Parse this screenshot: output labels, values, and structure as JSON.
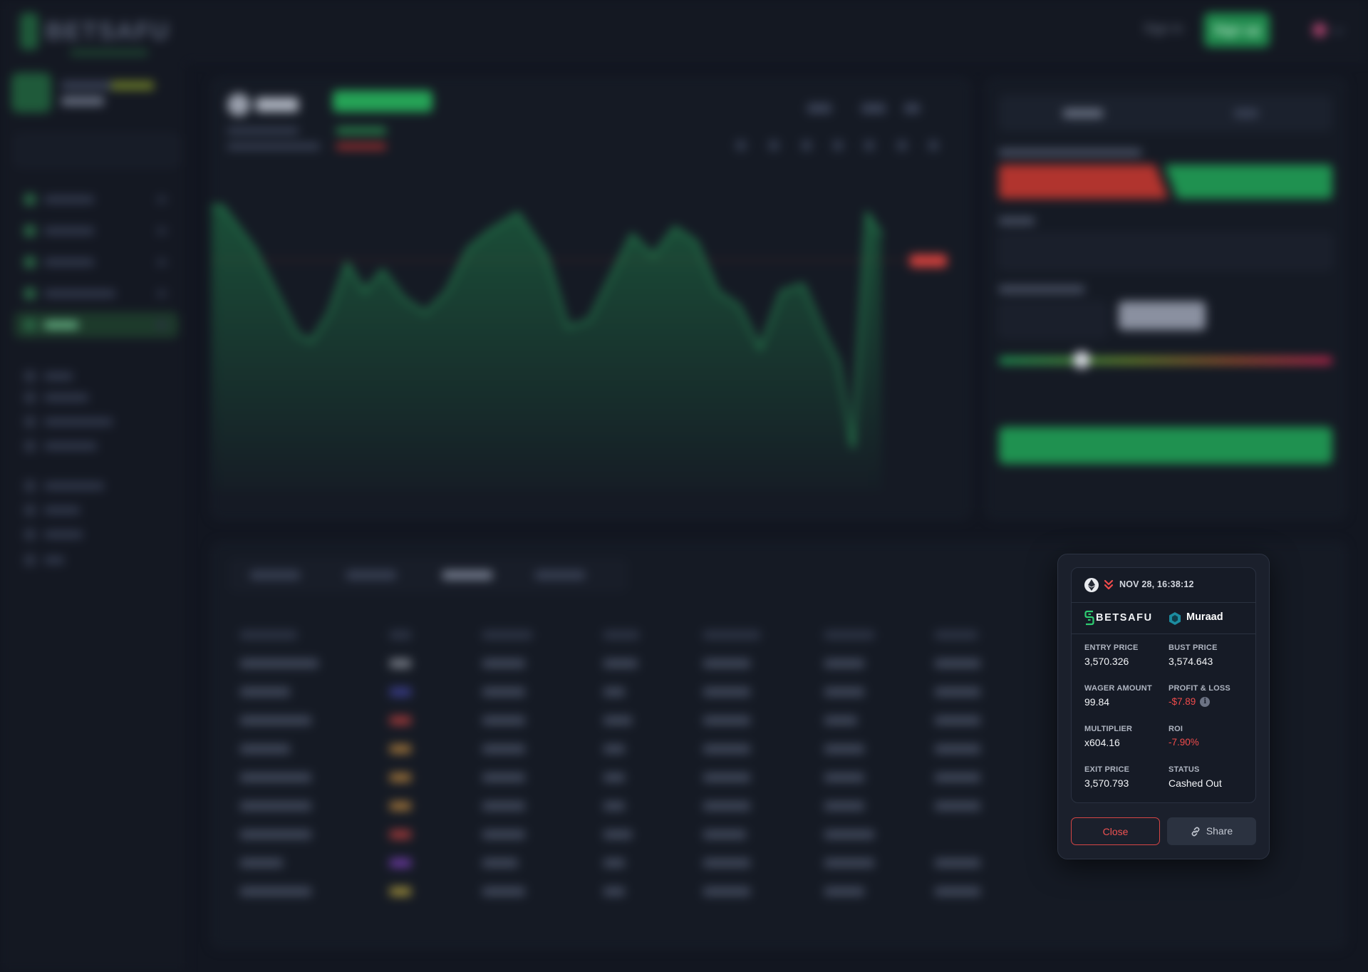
{
  "background": {
    "header": {
      "brand": "BETSAFU",
      "signin_label": "Sign in",
      "signup_label": "Sign up"
    },
    "chart_panel": {
      "symbol": "ETH"
    }
  },
  "modal": {
    "timestamp": "NOV 28, 16:38:12",
    "asset_icon": "ethereum-icon",
    "direction_icon": "double-chevron-down-icon",
    "brand": "BETSAFU",
    "username": "Muraad",
    "stats": {
      "entry_price": {
        "label": "ENTRY PRICE",
        "value": "3,570.326"
      },
      "bust_price": {
        "label": "BUST PRICE",
        "value": "3,574.643"
      },
      "wager_amount": {
        "label": "WAGER AMOUNT",
        "value": "99.84"
      },
      "profit_loss": {
        "label": "PROFIT & LOSS",
        "value": "-$7.89"
      },
      "multiplier": {
        "label": "MULTIPLIER",
        "value": "x604.16"
      },
      "roi": {
        "label": "ROI",
        "value": "-7.90%"
      },
      "exit_price": {
        "label": "EXIT PRICE",
        "value": "3,570.793"
      },
      "status": {
        "label": "STATUS",
        "value": "Cashed Out"
      }
    },
    "close_label": "Close",
    "share_label": "Share"
  },
  "colors": {
    "accent_green": "#25a356",
    "loss_red": "#ef4b4b",
    "page_bg": "#121620",
    "modal_bg": "#1b202c"
  }
}
